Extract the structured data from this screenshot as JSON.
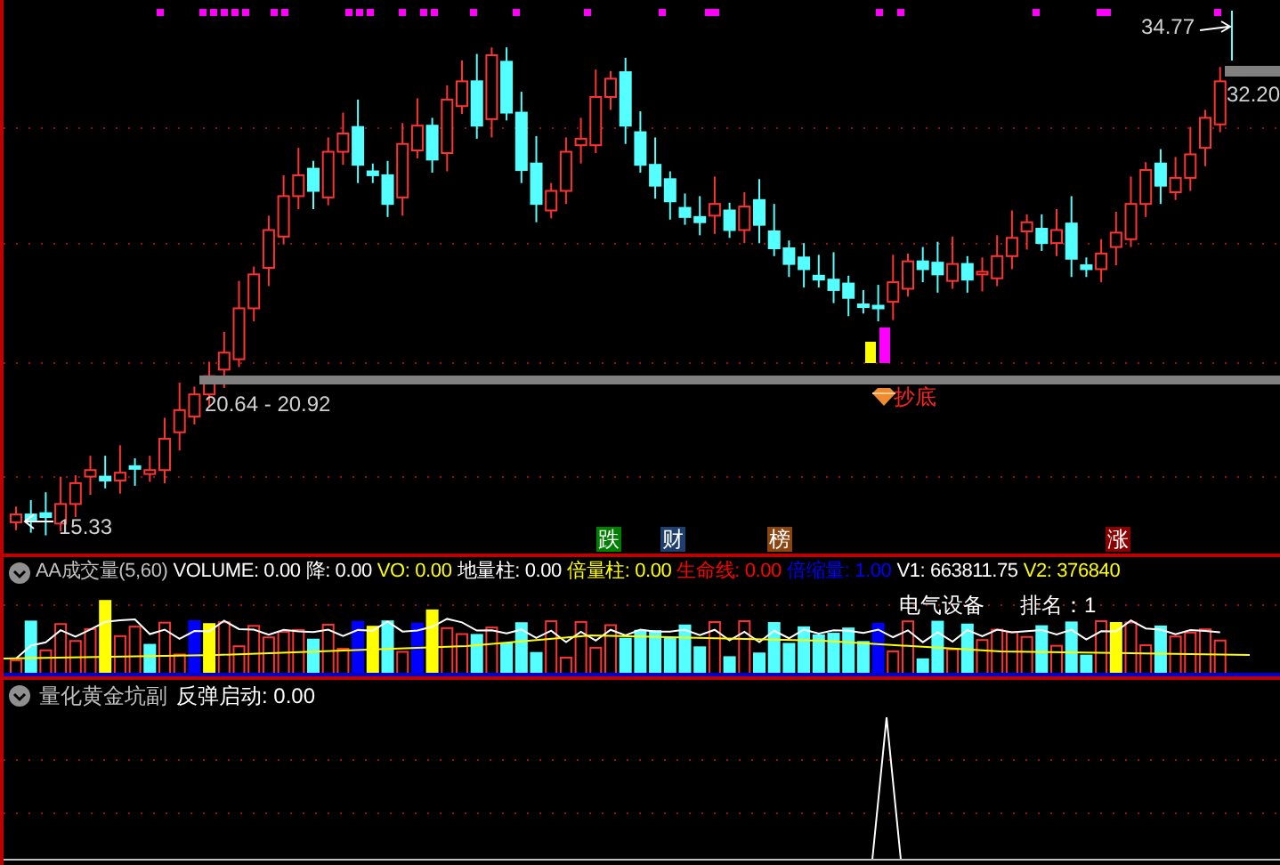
{
  "main_chart": {
    "high_label": "34.77",
    "last_label": "32.20",
    "range_label": "20.64 - 20.92",
    "low_label": "15.33",
    "signal_label": "抄底",
    "badges": [
      {
        "text": "跌",
        "color": "#008000"
      },
      {
        "text": "财",
        "color": "#1f3f6f"
      },
      {
        "text": "榜",
        "color": "#8b4513"
      },
      {
        "text": "涨",
        "color": "#8b0000"
      }
    ]
  },
  "volume_panel": {
    "indicators": [
      {
        "text": "AA成交量(5,60)",
        "color": "#c0c0c0"
      },
      {
        "text": "VOLUME: 0.00",
        "color": "#ffffff"
      },
      {
        "text": "降: 0.00",
        "color": "#ffffff"
      },
      {
        "text": "VO: 0.00",
        "color": "#ffff00"
      },
      {
        "text": "地量柱: 0.00",
        "color": "#ffffff"
      },
      {
        "text": "倍量柱: 0.00",
        "color": "#ffff00"
      },
      {
        "text": "生命线: 0.00",
        "color": "#ff0000"
      },
      {
        "text": "倍缩量: 1.00",
        "color": "#0000ff"
      },
      {
        "text": "V1: 663811.75",
        "color": "#ffffff"
      },
      {
        "text": "V2: 376840",
        "color": "#ffff00"
      }
    ],
    "sector": "电气设备",
    "rank": "排名：1"
  },
  "indicator_panel": {
    "title": "量化黄金坑副",
    "indicators": [
      {
        "text": "反弹启动: 0.00",
        "color": "#ffffff"
      }
    ]
  }
}
